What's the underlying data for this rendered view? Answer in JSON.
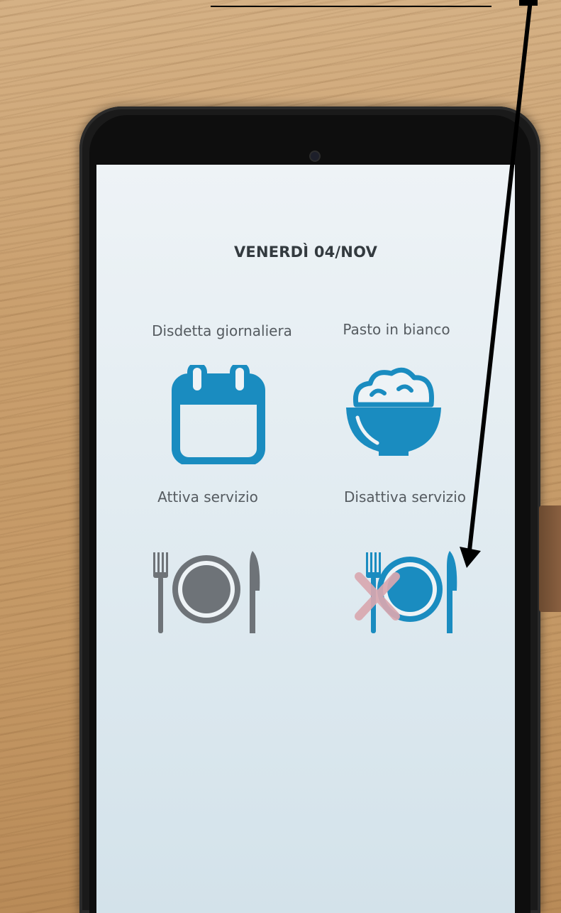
{
  "screen": {
    "date_title": "VENERDÌ 04/NOV"
  },
  "tiles": [
    {
      "label": "Disdetta giornaliera",
      "icon": "calendar-icon"
    },
    {
      "label": "Pasto in bianco",
      "icon": "rice-bowl-icon"
    },
    {
      "label": "Attiva servizio",
      "icon": "plate-cutlery-icon"
    },
    {
      "label": "Disattiva servizio",
      "icon": "plate-cutlery-crossed-icon"
    }
  ],
  "colors": {
    "accent_blue": "#1a8cc0",
    "inactive_gray": "#6e7378",
    "cross_pink": "#d9a8b0",
    "annotation": "#000000"
  }
}
